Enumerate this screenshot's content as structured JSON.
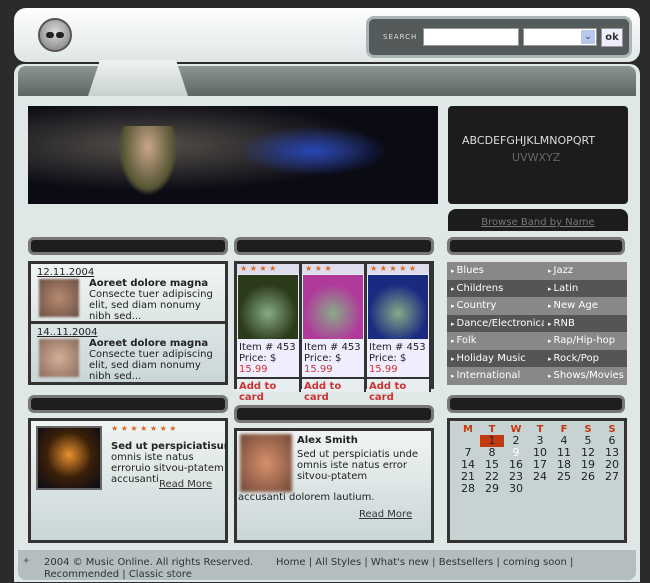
{
  "header": {
    "search_label": "SEARCH",
    "search_value": "",
    "select_value": "",
    "ok_label": "ok"
  },
  "alphabet": {
    "letters": [
      "A",
      "B",
      "C",
      "D",
      "E",
      "F",
      "G",
      "H",
      "J",
      "K",
      "L",
      "M",
      "N",
      "O",
      "P",
      "Q",
      "R",
      "T"
    ],
    "faint_letters": [
      "U",
      "V",
      "W",
      "X",
      "Y",
      "Z"
    ],
    "browse_label": "Browse Band by Name"
  },
  "news": [
    {
      "date": "12.11.2004",
      "title": "Aoreet dolore magna",
      "text": "Consecte tuer adipiscing elit, sed diam nonumy nibh sed..."
    },
    {
      "date": "14..11.2004",
      "title": "Aoreet dolore magna",
      "text": "Consecte tuer adipiscing elit, sed diam nonumy nibh sed..."
    }
  ],
  "products": [
    {
      "stars": "★ ★ ★ ★",
      "item": "Item # 453",
      "price_label": "Price: $",
      "price": "15.99",
      "add": "Add to card",
      "cover_color": "#2a3a1a"
    },
    {
      "stars": "★ ★ ★",
      "item": "Item # 453",
      "price_label": "Price: $",
      "price": "15.99",
      "add": "Add to card",
      "cover_color": "#b03a9a"
    },
    {
      "stars": "★ ★ ★ ★ ★",
      "item": "Item # 453",
      "price_label": "Price: $",
      "price": "15.99",
      "add": "Add to card",
      "cover_color": "#1a2a80"
    }
  ],
  "genres": [
    "Blues",
    "Jazz",
    "Childrens",
    "Latin",
    "Country",
    "New Age",
    "Dance/Electronica",
    "RNB",
    "Folk",
    "Rap/Hip-hop",
    "Holiday Music",
    "Rock/Pop",
    "International",
    "Shows/Movies"
  ],
  "feature": {
    "stars": "★ ★ ★ ★ ★ ★ ★",
    "title": "Sed ut perspiciatisun",
    "text": "omnis iste natus erroruio sitvou-ptatem accusanti",
    "read_more": "Read More"
  },
  "testimonial": {
    "name": "Alex Smith",
    "text": "Sed ut perspiciatis unde omnis iste natus error sitvou-ptatem",
    "text2": "accusanti dolorem lautium.",
    "read_more": "Read More"
  },
  "calendar": {
    "headers": [
      "M",
      "T",
      "W",
      "T",
      "F",
      "S",
      "S"
    ],
    "highlight_day": 1,
    "selected_day": 9,
    "accent": "#c43a10"
  },
  "footer": {
    "copyright": "2004 © Music Online. All rights Reserved.",
    "links": [
      "Home",
      "All Styles",
      "What's new",
      "Bestsellers",
      "coming soon",
      "Recommended",
      "Classic store"
    ]
  }
}
